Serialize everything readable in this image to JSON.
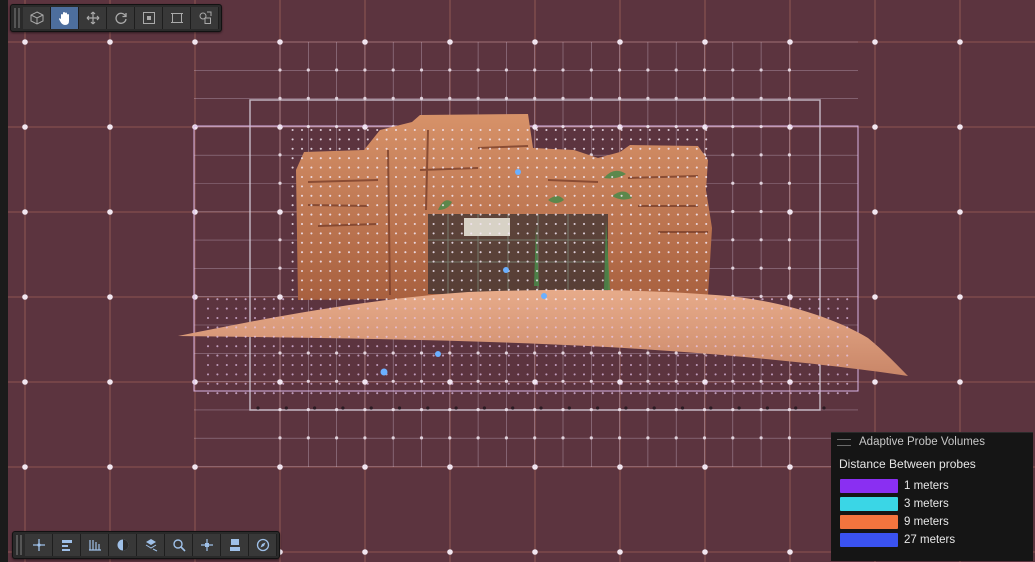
{
  "viewport": {
    "background": "#5c343f",
    "grid_line_color": "#d6866f",
    "probe_color": "#f1e6f0"
  },
  "top_toolbar": {
    "tools": [
      {
        "name": "view-cube-icon",
        "active": false
      },
      {
        "name": "hand-tool-icon",
        "active": true
      },
      {
        "name": "move-tool-icon",
        "active": false
      },
      {
        "name": "rotate-tool-icon",
        "active": false
      },
      {
        "name": "scale-tool-icon",
        "active": false
      },
      {
        "name": "rect-tool-icon",
        "active": false
      },
      {
        "name": "transform-tool-icon",
        "active": false
      }
    ]
  },
  "bottom_toolbar": {
    "tools": [
      {
        "name": "gizmo-move-icon"
      },
      {
        "name": "grid-snap-icon"
      },
      {
        "name": "hierarchy-icon"
      },
      {
        "name": "lighting-icon"
      },
      {
        "name": "layers-icon"
      },
      {
        "name": "search-icon"
      },
      {
        "name": "pivot-icon"
      },
      {
        "name": "camera-icon"
      },
      {
        "name": "compass-icon"
      }
    ]
  },
  "overlay": {
    "title": "Adaptive Probe Volumes",
    "subtitle": "Distance Between probes",
    "legend": [
      {
        "label": "1 meters",
        "color": "#8a2ff2"
      },
      {
        "label": "3 meters",
        "color": "#3ad6e6"
      },
      {
        "label": "9 meters",
        "color": "#f2743e"
      },
      {
        "label": "27 meters",
        "color": "#3a52f0"
      }
    ]
  }
}
